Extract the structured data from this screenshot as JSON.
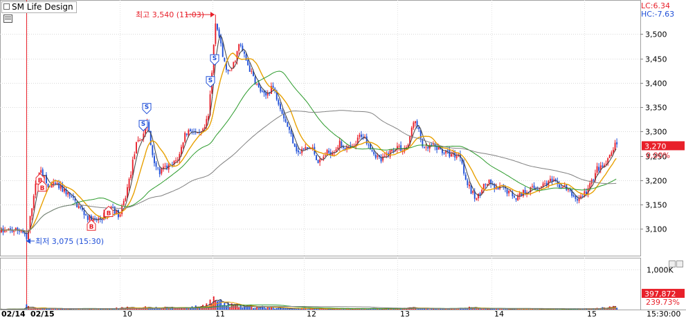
{
  "app": {
    "title": "SM Life Design",
    "lc_label": "LC:6.34",
    "hc_label": "HC:-7.63"
  },
  "colors": {
    "up": "#e8202a",
    "down": "#1f4fd8",
    "ma_fast": "#404040",
    "ma_mid": "#e8a000",
    "ma_slow": "#2a9a2a",
    "ma_long": "#808080",
    "current_box": "#e8202a"
  },
  "chart_data": {
    "type": "candlestick",
    "price_axis": {
      "ticks": [
        "3,500",
        "3,450",
        "3,400",
        "3,350",
        "3,300",
        "3,250",
        "3,200",
        "3,150",
        "3,100"
      ],
      "range": [
        3045,
        3570
      ]
    },
    "volume_axis": {
      "ticks": [
        "1,000K"
      ],
      "range": [
        0,
        1300
      ]
    },
    "x_labels": [
      "02/14",
      "02/15",
      "10",
      "11",
      "12",
      "13",
      "14",
      "15",
      "15:30:00"
    ],
    "annotations": {
      "high": "최고 3,540 (11:03)",
      "low": "최저 3,075 (15:30)"
    },
    "current": {
      "price": "3,270",
      "change": "0.00%",
      "volume": "397,872",
      "volume_change": "239.73%"
    },
    "signals": [
      "B",
      "B",
      "B",
      "B",
      "S",
      "S",
      "S",
      "S"
    ],
    "price_path": [
      [
        0,
        3095
      ],
      [
        30,
        3098
      ],
      [
        38,
        3075
      ],
      [
        48,
        3175
      ],
      [
        58,
        3225
      ],
      [
        68,
        3185
      ],
      [
        80,
        3190
      ],
      [
        95,
        3175
      ],
      [
        110,
        3150
      ],
      [
        125,
        3125
      ],
      [
        135,
        3115
      ],
      [
        148,
        3125
      ],
      [
        160,
        3145
      ],
      [
        172,
        3125
      ],
      [
        180,
        3165
      ],
      [
        188,
        3215
      ],
      [
        195,
        3270
      ],
      [
        205,
        3290
      ],
      [
        212,
        3320
      ],
      [
        218,
        3260
      ],
      [
        228,
        3215
      ],
      [
        238,
        3225
      ],
      [
        248,
        3230
      ],
      [
        258,
        3250
      ],
      [
        266,
        3295
      ],
      [
        275,
        3305
      ],
      [
        285,
        3290
      ],
      [
        293,
        3300
      ],
      [
        300,
        3330
      ],
      [
        305,
        3415
      ],
      [
        310,
        3530
      ],
      [
        315,
        3500
      ],
      [
        322,
        3445
      ],
      [
        330,
        3415
      ],
      [
        338,
        3445
      ],
      [
        345,
        3480
      ],
      [
        352,
        3455
      ],
      [
        362,
        3420
      ],
      [
        372,
        3390
      ],
      [
        382,
        3370
      ],
      [
        392,
        3395
      ],
      [
        402,
        3360
      ],
      [
        412,
        3320
      ],
      [
        420,
        3290
      ],
      [
        430,
        3255
      ],
      [
        440,
        3265
      ],
      [
        450,
        3265
      ],
      [
        460,
        3235
      ],
      [
        470,
        3255
      ],
      [
        480,
        3260
      ],
      [
        490,
        3275
      ],
      [
        500,
        3265
      ],
      [
        510,
        3265
      ],
      [
        520,
        3295
      ],
      [
        530,
        3280
      ],
      [
        540,
        3255
      ],
      [
        550,
        3240
      ],
      [
        560,
        3255
      ],
      [
        572,
        3270
      ],
      [
        582,
        3262
      ],
      [
        590,
        3275
      ],
      [
        596,
        3325
      ],
      [
        603,
        3305
      ],
      [
        612,
        3260
      ],
      [
        622,
        3270
      ],
      [
        632,
        3265
      ],
      [
        645,
        3255
      ],
      [
        655,
        3252
      ],
      [
        665,
        3250
      ],
      [
        672,
        3200
      ],
      [
        680,
        3175
      ],
      [
        688,
        3160
      ],
      [
        695,
        3185
      ],
      [
        705,
        3195
      ],
      [
        715,
        3180
      ],
      [
        725,
        3185
      ],
      [
        735,
        3175
      ],
      [
        745,
        3165
      ],
      [
        755,
        3175
      ],
      [
        765,
        3182
      ],
      [
        775,
        3185
      ],
      [
        785,
        3192
      ],
      [
        795,
        3198
      ],
      [
        805,
        3190
      ],
      [
        815,
        3185
      ],
      [
        825,
        3170
      ],
      [
        833,
        3160
      ],
      [
        840,
        3168
      ],
      [
        848,
        3180
      ],
      [
        855,
        3200
      ],
      [
        862,
        3225
      ],
      [
        870,
        3225
      ],
      [
        878,
        3240
      ],
      [
        886,
        3270
      ],
      [
        892,
        3270
      ]
    ],
    "volume_path": [
      [
        0,
        8
      ],
      [
        35,
        20
      ],
      [
        38,
        140
      ],
      [
        45,
        45
      ],
      [
        60,
        35
      ],
      [
        80,
        25
      ],
      [
        100,
        20
      ],
      [
        130,
        20
      ],
      [
        160,
        25
      ],
      [
        180,
        60
      ],
      [
        190,
        40
      ],
      [
        210,
        70
      ],
      [
        230,
        50
      ],
      [
        260,
        55
      ],
      [
        290,
        80
      ],
      [
        305,
        240
      ],
      [
        310,
        300
      ],
      [
        318,
        180
      ],
      [
        330,
        130
      ],
      [
        350,
        90
      ],
      [
        370,
        70
      ],
      [
        400,
        50
      ],
      [
        430,
        35
      ],
      [
        460,
        25
      ],
      [
        500,
        25
      ],
      [
        540,
        25
      ],
      [
        580,
        25
      ],
      [
        596,
        55
      ],
      [
        610,
        30
      ],
      [
        660,
        25
      ],
      [
        675,
        55
      ],
      [
        700,
        25
      ],
      [
        750,
        20
      ],
      [
        800,
        18
      ],
      [
        840,
        18
      ],
      [
        860,
        30
      ],
      [
        885,
        70
      ],
      [
        892,
        135
      ]
    ],
    "moving_averages": [
      {
        "window": 5,
        "color": "ma_fast"
      },
      {
        "window": 12,
        "color": "ma_mid"
      },
      {
        "window": 40,
        "color": "ma_slow"
      },
      {
        "window": 90,
        "color": "ma_long"
      }
    ]
  }
}
